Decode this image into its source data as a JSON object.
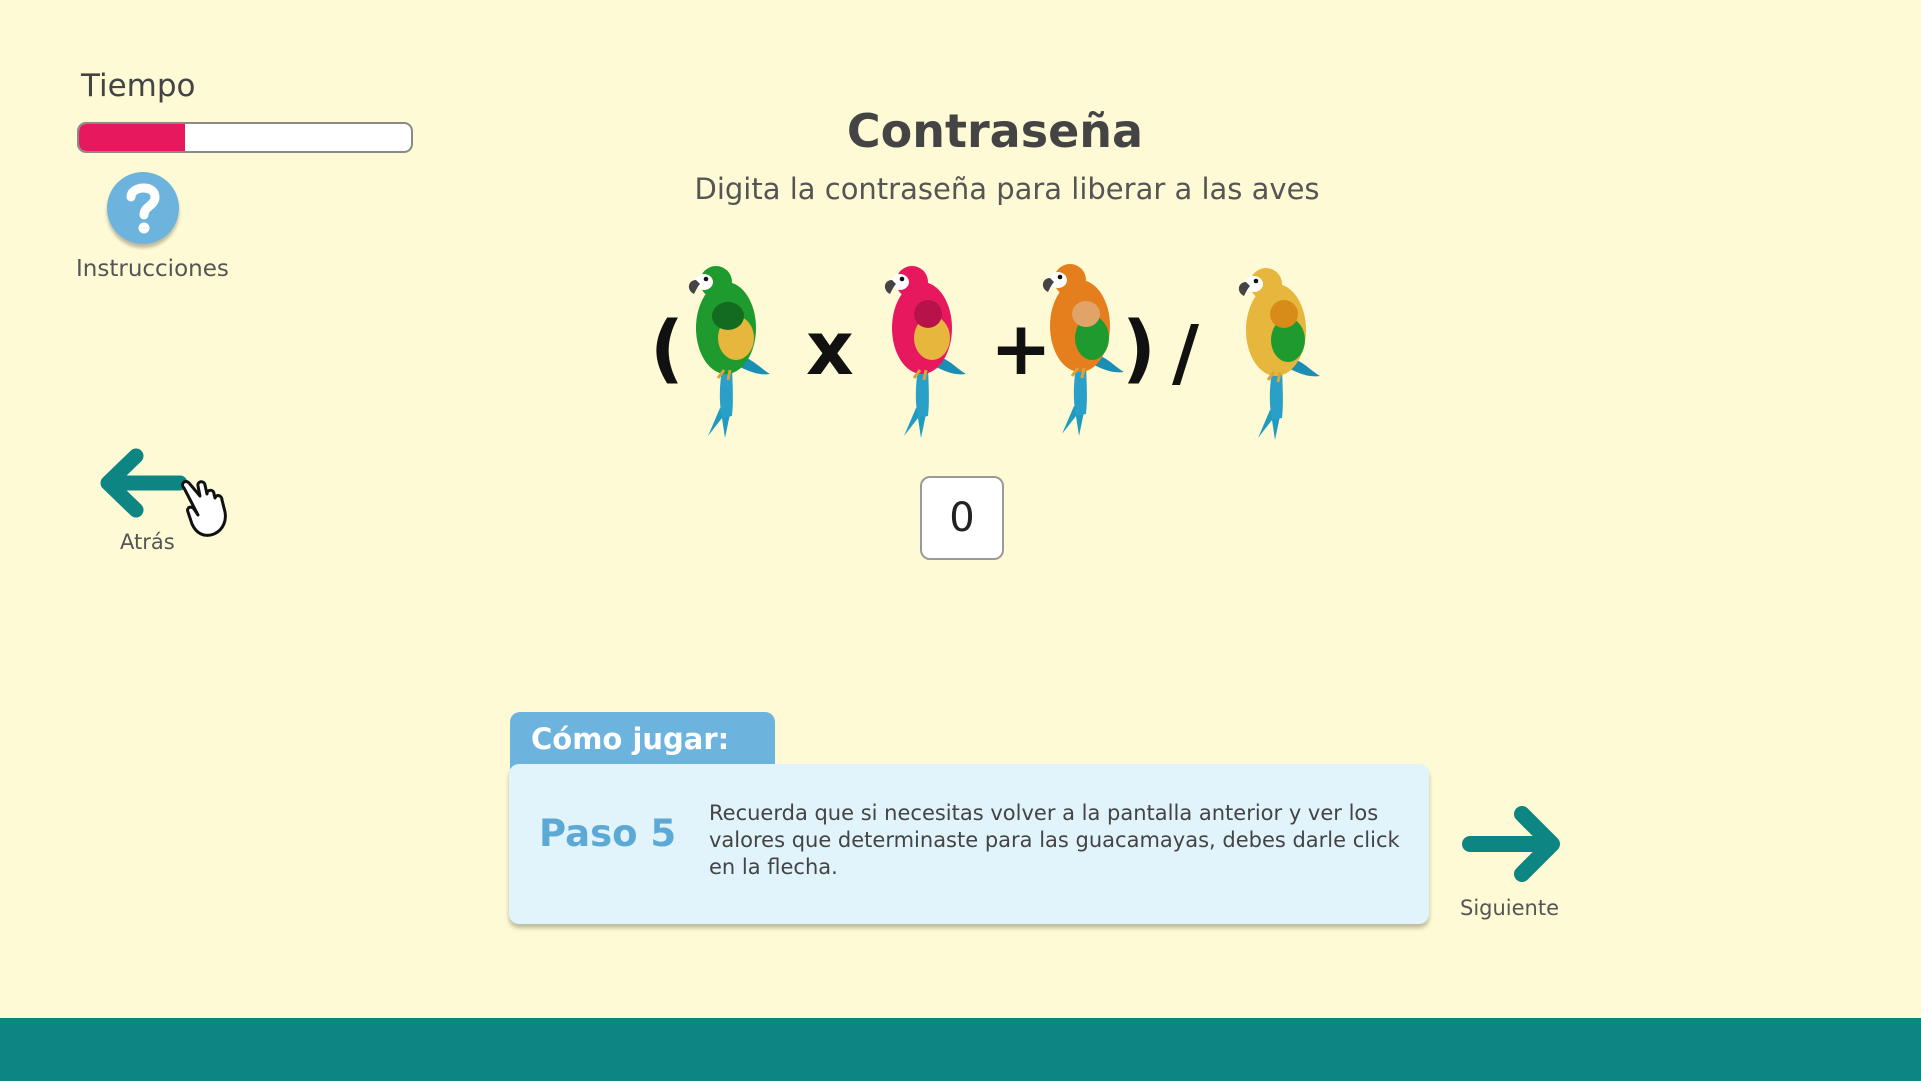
{
  "timer": {
    "label": "Tiempo",
    "progress": 0.32,
    "fill_color": "#e8185f"
  },
  "help": {
    "icon": "question-mark-icon",
    "label": "Instrucciones"
  },
  "back": {
    "label": "Atrás",
    "icon": "arrow-left-icon"
  },
  "title": "Contraseña",
  "subtitle": "Digita la contraseña para liberar a las aves",
  "equation": {
    "open_paren": "(",
    "times": "x",
    "plus": "+",
    "close_paren": ")",
    "divide": "/",
    "birds": [
      "green-macaw",
      "pink-macaw",
      "orange-macaw",
      "yellow-macaw"
    ]
  },
  "answer_value": "0",
  "how_to_play": {
    "tab_label": "Cómo jugar:",
    "step_label": "Paso 5",
    "step_text": "Recuerda que si necesitas volver a la pantalla anterior y ver los valores que determinaste para las guacamayas, debes darle click en la flecha."
  },
  "next": {
    "label": "Siguiente",
    "icon": "arrow-right-icon"
  },
  "colors": {
    "background": "#fefad5",
    "accent_teal": "#0d8583",
    "accent_blue": "#6cb4de",
    "timer_pink": "#e8185f"
  }
}
